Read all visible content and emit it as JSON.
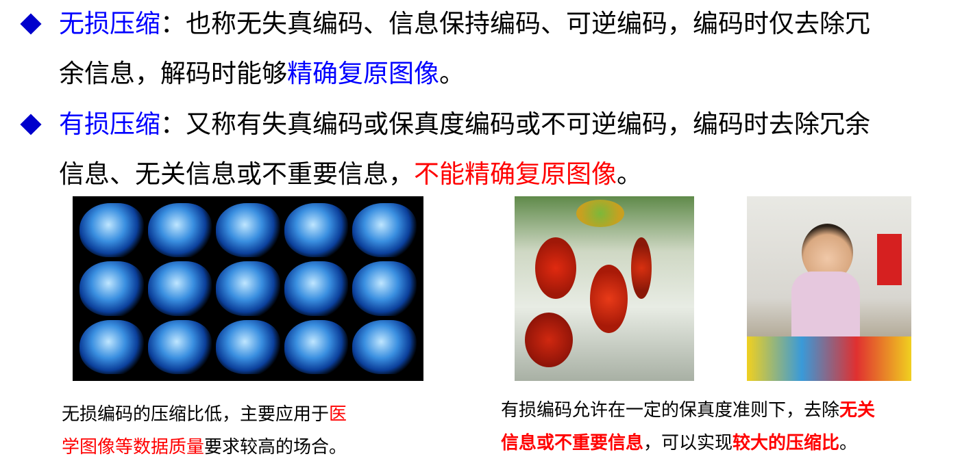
{
  "bullets": [
    {
      "term": "无损压缩",
      "line1_rest": "：也称无失真编码、信息保持编码、可逆编码，编码时仅去除冗",
      "line2_plain": "余信息，解码时能够",
      "line2_highlight": "精确复原图像",
      "line2_end": "。"
    },
    {
      "term": "有损压缩",
      "line1_rest": "：又称有失真编码或保真度编码或不可逆编码，编码时去除冗余",
      "line2_plain": "信息、无关信息或不重要信息，",
      "line2_highlight": "不能精确复原图像",
      "line2_end": "。"
    }
  ],
  "captions": {
    "lossless": {
      "l1_plain": "无损编码的压缩比低，主要应用于",
      "l1_red": "医",
      "l2_red": "学图像等数据质量",
      "l2_plain": "要求较高的场合。"
    },
    "lossy": {
      "l1_plain": "有损编码允许在一定的保真度准则下，去除",
      "l1_red": "无关",
      "l2_red": "信息或不重要信息",
      "l2_plain": "，可以实现",
      "l2_red2": "较大的压缩比",
      "l2_end": "。"
    }
  },
  "colors": {
    "term": "#0000ff",
    "highlight_blue": "#0000ff",
    "highlight_red": "#ff0000",
    "bullet": "#0000cc"
  },
  "icons": [
    "diamond-bullet-icon"
  ],
  "images": [
    "mri-brain-scans-image",
    "tomato-greenhouse-image",
    "child-photo-image"
  ]
}
